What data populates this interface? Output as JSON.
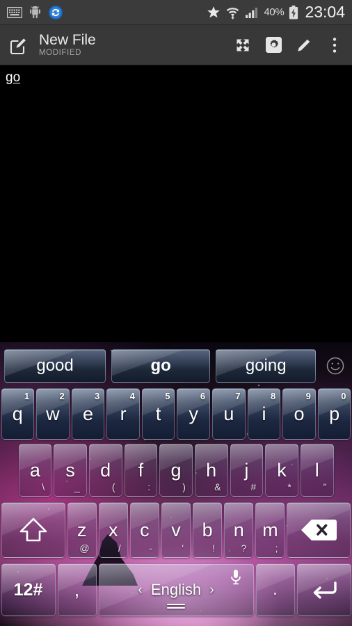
{
  "status_bar": {
    "left_icons": [
      {
        "name": "keyboard-active-icon",
        "label": "keyboard"
      },
      {
        "name": "android-icon",
        "label": "android"
      },
      {
        "name": "sync-icon",
        "label": "sync"
      }
    ],
    "right_icons": [
      {
        "name": "star-icon",
        "label": "star"
      },
      {
        "name": "wifi-icon",
        "label": "wifi-download"
      },
      {
        "name": "signal-icon",
        "label": "cellular-signal"
      }
    ],
    "battery_percent": "40%",
    "battery_state": "charging",
    "clock": "23:04"
  },
  "action_bar": {
    "app_icon": "edit-document-icon",
    "title": "New File",
    "subtitle": "MODIFIED",
    "actions": [
      {
        "name": "fullscreen-button",
        "icon": "expand-arrows-icon"
      },
      {
        "name": "settings-button",
        "icon": "gear-icon"
      },
      {
        "name": "edit-button",
        "icon": "pencil-icon"
      },
      {
        "name": "overflow-menu-button",
        "icon": "more-vertical-icon"
      }
    ]
  },
  "editor": {
    "composing_text": "go"
  },
  "keyboard": {
    "suggestions": [
      {
        "label": "good",
        "active": false
      },
      {
        "label": "go",
        "active": true
      },
      {
        "label": "going",
        "active": false
      }
    ],
    "emoji_button": "smiley-icon",
    "row1": [
      {
        "key": "q",
        "num": "1"
      },
      {
        "key": "w",
        "num": "2"
      },
      {
        "key": "e",
        "num": "3"
      },
      {
        "key": "r",
        "num": "4"
      },
      {
        "key": "t",
        "num": "5"
      },
      {
        "key": "y",
        "num": "6"
      },
      {
        "key": "u",
        "num": "7"
      },
      {
        "key": "i",
        "num": "8"
      },
      {
        "key": "o",
        "num": "9"
      },
      {
        "key": "p",
        "num": "0"
      }
    ],
    "row2": [
      {
        "key": "a",
        "alt": "\\"
      },
      {
        "key": "s",
        "alt": "_"
      },
      {
        "key": "d",
        "alt": "("
      },
      {
        "key": "f",
        "alt": ":"
      },
      {
        "key": "g",
        "alt": ")"
      },
      {
        "key": "h",
        "alt": "&"
      },
      {
        "key": "j",
        "alt": "#"
      },
      {
        "key": "k",
        "alt": "*"
      },
      {
        "key": "l",
        "alt": "\""
      }
    ],
    "row3": [
      {
        "key": "z",
        "alt": "@"
      },
      {
        "key": "x",
        "alt": "/"
      },
      {
        "key": "c",
        "alt": "-"
      },
      {
        "key": "v",
        "alt": "'"
      },
      {
        "key": "b",
        "alt": "!"
      },
      {
        "key": "n",
        "alt": "?"
      },
      {
        "key": "m",
        "alt": ";"
      }
    ],
    "shift_key": "shift-icon",
    "backspace_key": "backspace-icon",
    "symbols_key_label": "12#",
    "comma_key_label": ",",
    "period_key_label": ".",
    "space_language": "English",
    "space_prev_arrow": "‹",
    "space_next_arrow": "›",
    "mic_key": "microphone-icon",
    "enter_key": "enter-icon"
  },
  "colors": {
    "statusbar_bg": "#3b3b3b",
    "actionbar_bg": "#383838",
    "editor_bg": "#000000",
    "suggestion_text": "#ffffff",
    "key_text": "#ffffff",
    "nebula_pink": "#d44fb0",
    "nebula_light": "#ffd0f5"
  }
}
